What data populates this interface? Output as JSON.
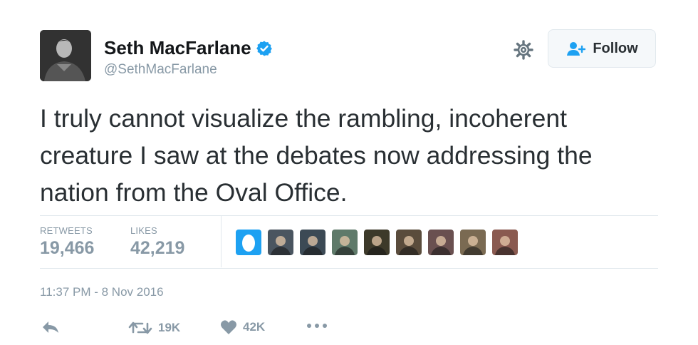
{
  "user": {
    "name": "Seth MacFarlane",
    "handle": "@SethMacFarlane",
    "avatar_icon": "profile-photo"
  },
  "follow_button": {
    "label": "Follow"
  },
  "tweet": {
    "lines": [
      "I truly cannot visualize the rambling, incoherent",
      "creature I saw at the debates now addressing the",
      "nation from the Oval Office."
    ]
  },
  "stats": {
    "retweets_label": "RETWEETS",
    "retweets_value": "19,466",
    "likes_label": "LIKES",
    "likes_value": "42,219"
  },
  "likers": [
    {
      "icon": "egg-avatar",
      "bg": "#1da1f2"
    },
    {
      "icon": "user-avatar",
      "bg": "#4a5560"
    },
    {
      "icon": "user-avatar",
      "bg": "#3c4a55"
    },
    {
      "icon": "user-avatar",
      "bg": "#5f7a6a"
    },
    {
      "icon": "user-avatar",
      "bg": "#3d3a2a"
    },
    {
      "icon": "user-avatar",
      "bg": "#5a4c3c"
    },
    {
      "icon": "user-avatar",
      "bg": "#6a5050"
    },
    {
      "icon": "user-avatar",
      "bg": "#7a6a52"
    },
    {
      "icon": "user-avatar",
      "bg": "#8a5a50"
    }
  ],
  "timestamp": "11:37 PM - 8 Nov 2016",
  "actions": {
    "reply_icon": "reply-icon",
    "retweet_count": "19K",
    "like_count": "42K",
    "more_icon": "more-icon"
  },
  "colors": {
    "verified": "#1da1f2",
    "follow_icon": "#1da1f2",
    "muted": "#8899a6",
    "text": "#292f33"
  }
}
